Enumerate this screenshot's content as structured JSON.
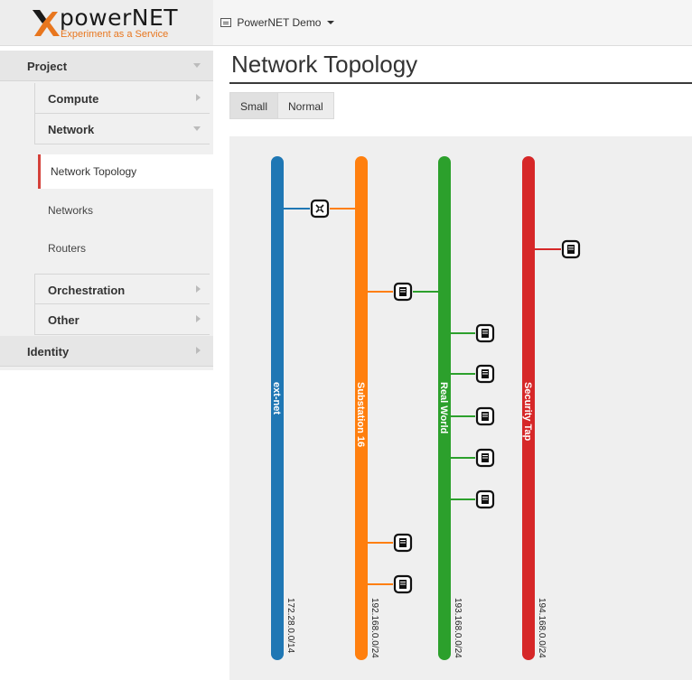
{
  "brand": {
    "name": "powerNET",
    "tagline": "Experiment as a Service"
  },
  "project_selector": {
    "label": "PowerNET Demo"
  },
  "sidebar": {
    "project": "Project",
    "compute": "Compute",
    "network": "Network",
    "network_items": [
      "Network Topology",
      "Networks",
      "Routers"
    ],
    "orchestration": "Orchestration",
    "other": "Other",
    "identity": "Identity"
  },
  "main": {
    "title": "Network Topology",
    "size_buttons": [
      "Small",
      "Normal"
    ],
    "active_size": "Small"
  },
  "topology": {
    "networks": [
      {
        "name": "ext-net",
        "cidr": "172.28.0.0/14",
        "color": "#1f77b4"
      },
      {
        "name": "Substation 16",
        "cidr": "192.168.0.0/24",
        "color": "#ff7f0e"
      },
      {
        "name": "Real World",
        "cidr": "193.168.0.0/24",
        "color": "#2ca02c"
      },
      {
        "name": "Security Tap",
        "cidr": "194.168.0.0/24",
        "color": "#d62728"
      }
    ],
    "devices": [
      {
        "type": "router",
        "links": [
          0,
          1
        ]
      },
      {
        "type": "instance",
        "links": [
          1,
          2
        ]
      },
      {
        "type": "instance",
        "links": [
          3
        ]
      },
      {
        "type": "instance",
        "links": [
          2
        ]
      },
      {
        "type": "instance",
        "links": [
          2
        ]
      },
      {
        "type": "instance",
        "links": [
          2
        ]
      },
      {
        "type": "instance",
        "links": [
          2
        ]
      },
      {
        "type": "instance",
        "links": [
          2
        ]
      },
      {
        "type": "instance",
        "links": [
          1
        ]
      },
      {
        "type": "instance",
        "links": [
          1
        ]
      }
    ]
  }
}
